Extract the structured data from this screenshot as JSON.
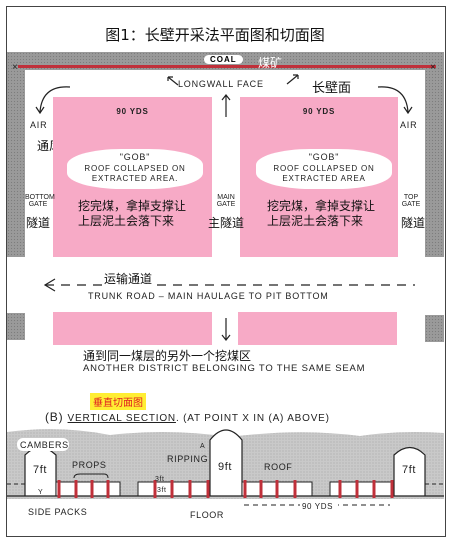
{
  "title": "图1：长壁开采法平面图和切面图",
  "plan": {
    "coal_label": "COAL",
    "coal_cn": "煤矿",
    "longwall_face": "LONGWALL FACE",
    "longwall_face_cn": "长壁面",
    "air_left": "AIR",
    "air_right": "AIR",
    "air_cn": "通风",
    "panels": [
      {
        "width_label": "90 YDS",
        "gob": "\"GOB\"",
        "gob_desc_1": "ROOF COLLAPSED ON",
        "gob_desc_2": "EXTRACTED AREA.",
        "cn_1": "挖完煤，拿掉支撑让",
        "cn_2": "上层泥土会落下来"
      },
      {
        "width_label": "90 YDS",
        "gob": "\"GOB\"",
        "gob_desc_1": "ROOF COLLAPSED ON",
        "gob_desc_2": "EXTRACTED   AREA",
        "cn_1": "挖完煤，拿掉支撑让",
        "cn_2": "上层泥土会落下来"
      }
    ],
    "gates": [
      {
        "line1": "BOTTOM",
        "line2": "GATE",
        "cn": "隧道"
      },
      {
        "line1": "MAIN",
        "line2": "GATE",
        "cn": "主隧道"
      },
      {
        "line1": "TOP",
        "line2": "GATE",
        "cn": "隧道"
      }
    ],
    "trunk_road_cn": "运输通道",
    "trunk_road": "TRUNK ROAD  –  MAIN  HAULAGE TO PIT BOTTOM",
    "another_district_cn": "通到同一煤层的另外一个挖煤区",
    "another_district": "ANOTHER  DISTRICT BELONGING  TO THE SAME SEAM"
  },
  "section": {
    "title_cn": "垂直切面图",
    "prefix": "(B)",
    "title": "VERTICAL SECTION",
    "suffix": ". (AT POINT X IN (A) ABOVE)",
    "cambers": "CAMBERS",
    "props": "PROPS",
    "ripping": "RIPPING",
    "roof": "ROOF",
    "side_packs": "SIDE PACKS",
    "floor": "FLOOR",
    "h_left": "7ft",
    "h_main": "9ft",
    "h_right": "7ft",
    "seam_3ft_a": "3ft",
    "seam_3ft_b": "3ft",
    "width_label": "90 YDS",
    "mark_a": "A",
    "mark_y": "Y"
  },
  "colors": {
    "pink": "#f7aac6",
    "red_line": "#c0303a",
    "prop": "#c0303a",
    "highlight": "#ffee33"
  }
}
